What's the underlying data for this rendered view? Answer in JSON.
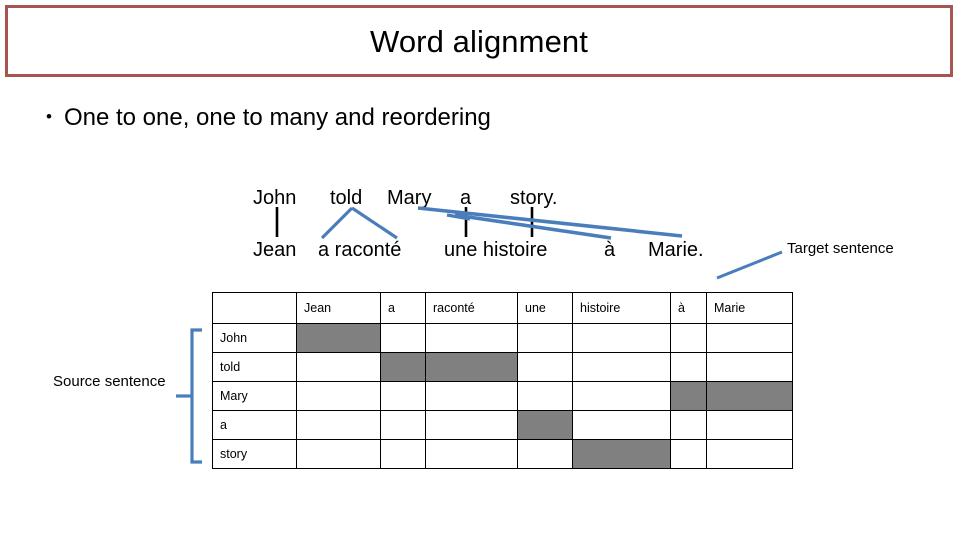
{
  "slide": {
    "title": "Word alignment",
    "bullet_marker": "•",
    "bullet_text": "One to one, one to many and reordering",
    "title_border_color": "#a85450",
    "link_color": "#4a7ebb",
    "fill_color": "#808080"
  },
  "sentences": {
    "source_words": [
      "John",
      "told",
      "Mary",
      "a",
      "story."
    ],
    "target_words": [
      "Jean",
      "a raconté",
      "une histoire",
      "à",
      "Marie."
    ]
  },
  "labels": {
    "target": "Target sentence",
    "source": "Source sentence"
  },
  "matrix": {
    "corner": "",
    "columns": [
      "Jean",
      "a",
      "raconté",
      "une",
      "histoire",
      "à",
      "Marie"
    ],
    "rows": [
      {
        "label": "John",
        "cells": [
          1,
          0,
          0,
          0,
          0,
          0,
          0
        ]
      },
      {
        "label": "told",
        "cells": [
          0,
          1,
          1,
          0,
          0,
          0,
          0
        ]
      },
      {
        "label": "Mary",
        "cells": [
          0,
          0,
          0,
          0,
          0,
          1,
          1
        ]
      },
      {
        "label": "a",
        "cells": [
          0,
          0,
          0,
          1,
          0,
          0,
          0
        ]
      },
      {
        "label": "story",
        "cells": [
          0,
          0,
          0,
          0,
          1,
          0,
          0
        ]
      }
    ]
  }
}
